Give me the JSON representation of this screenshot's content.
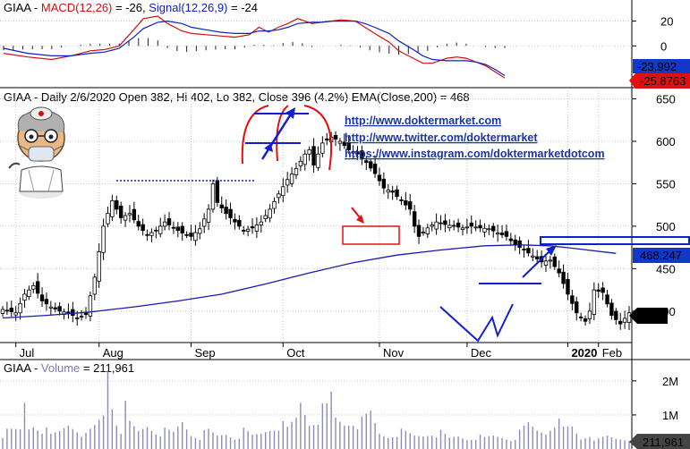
{
  "chart_data": [
    {
      "type": "line",
      "panel": "macd",
      "title": "GIAA - MACD(12,26) = -26, Signal(12,26,9) = -24",
      "title_parts": {
        "ticker": "GIAA - ",
        "macd_label": "MACD(12,26)",
        "macd_eq": " = -26, ",
        "signal_label": "Signal(12,26,9)",
        "signal_eq": " = -24"
      },
      "ylim": [
        -33,
        37
      ],
      "yticks": [
        "20",
        "0"
      ],
      "last_values": {
        "signal": "-23.992",
        "macd": "-25.8763"
      },
      "series": [
        {
          "name": "MACD(12,26)",
          "color": "#d01010",
          "points": [
            [
              0,
              -6
            ],
            [
              5,
              -9
            ],
            [
              10,
              -11
            ],
            [
              14,
              -8
            ],
            [
              18,
              -4
            ],
            [
              21,
              -3
            ],
            [
              24,
              0
            ],
            [
              27,
              13
            ],
            [
              29,
              22
            ],
            [
              32,
              24
            ],
            [
              34,
              18
            ],
            [
              37,
              12
            ],
            [
              39,
              10
            ],
            [
              42,
              9
            ],
            [
              45,
              8
            ],
            [
              48,
              7
            ],
            [
              51,
              9
            ],
            [
              53,
              15
            ],
            [
              55,
              11
            ],
            [
              57,
              15
            ],
            [
              59,
              18
            ],
            [
              61,
              22
            ],
            [
              64,
              18
            ],
            [
              66,
              19
            ],
            [
              68,
              20
            ],
            [
              70,
              21
            ],
            [
              73,
              20
            ],
            [
              75,
              15
            ],
            [
              77,
              10
            ],
            [
              80,
              3
            ],
            [
              82,
              -4
            ],
            [
              85,
              -10
            ],
            [
              87,
              -14
            ],
            [
              89,
              -14
            ],
            [
              92,
              -10
            ],
            [
              94,
              -9
            ],
            [
              96,
              -10
            ],
            [
              98,
              -13
            ],
            [
              100,
              -16
            ],
            [
              102,
              -21
            ],
            [
              104,
              -26
            ]
          ]
        },
        {
          "name": "Signal(12,26,9)",
          "color": "#1020c0",
          "points": [
            [
              0,
              -2
            ],
            [
              5,
              -6
            ],
            [
              10,
              -8
            ],
            [
              14,
              -8
            ],
            [
              18,
              -6
            ],
            [
              21,
              -5
            ],
            [
              24,
              -2
            ],
            [
              27,
              7
            ],
            [
              29,
              14
            ],
            [
              32,
              19
            ],
            [
              34,
              20
            ],
            [
              37,
              18
            ],
            [
              39,
              15
            ],
            [
              42,
              13
            ],
            [
              45,
              11
            ],
            [
              48,
              10
            ],
            [
              51,
              10
            ],
            [
              53,
              12
            ],
            [
              55,
              12
            ],
            [
              57,
              13
            ],
            [
              59,
              15
            ],
            [
              61,
              18
            ],
            [
              64,
              19
            ],
            [
              66,
              19
            ],
            [
              68,
              20
            ],
            [
              70,
              20
            ],
            [
              73,
              20
            ],
            [
              75,
              18
            ],
            [
              77,
              15
            ],
            [
              80,
              10
            ],
            [
              82,
              4
            ],
            [
              85,
              -3
            ],
            [
              87,
              -8
            ],
            [
              89,
              -11
            ],
            [
              92,
              -12
            ],
            [
              94,
              -12
            ],
            [
              96,
              -12
            ],
            [
              98,
              -13
            ],
            [
              100,
              -15
            ],
            [
              102,
              -19
            ],
            [
              104,
              -24
            ]
          ]
        }
      ]
    },
    {
      "type": "candlestick",
      "panel": "price",
      "title": "GIAA - Daily 2/6/2020 Open 382, Hi 402, Lo 382, Close 396 (4.2%) EMA(Close,200) = 468",
      "ylim": [
        363,
        660
      ],
      "yticks": [
        "650",
        "600",
        "550",
        "500",
        "450",
        "400"
      ],
      "xticks": [
        "Jul",
        "Aug",
        "Sep",
        "Oct",
        "Nov",
        "Dec",
        "2020",
        "Feb"
      ],
      "last_close_label": "396",
      "ema_label": "468.247",
      "links": [
        "http://www.doktermarket.com",
        "http://www.twitter.com/doktermarket",
        "https://www.instagram.com/doktermarketdotcom"
      ],
      "close_path": [
        [
          0,
          402
        ],
        [
          3,
          398
        ],
        [
          5,
          420
        ],
        [
          7,
          430
        ],
        [
          9,
          412
        ],
        [
          11,
          405
        ],
        [
          13,
          400
        ],
        [
          15,
          398
        ],
        [
          17,
          392
        ],
        [
          19,
          396
        ],
        [
          21,
          440
        ],
        [
          23,
          500
        ],
        [
          25,
          530
        ],
        [
          27,
          510
        ],
        [
          29,
          515
        ],
        [
          31,
          500
        ],
        [
          33,
          490
        ],
        [
          35,
          495
        ],
        [
          37,
          505
        ],
        [
          39,
          498
        ],
        [
          41,
          492
        ],
        [
          43,
          488
        ],
        [
          45,
          497
        ],
        [
          47,
          520
        ],
        [
          48,
          550
        ],
        [
          49,
          528
        ],
        [
          51,
          515
        ],
        [
          53,
          505
        ],
        [
          55,
          495
        ],
        [
          57,
          498
        ],
        [
          59,
          505
        ],
        [
          61,
          520
        ],
        [
          63,
          538
        ],
        [
          65,
          555
        ],
        [
          67,
          568
        ],
        [
          69,
          585
        ],
        [
          70,
          590
        ],
        [
          71,
          572
        ],
        [
          73,
          598
        ],
        [
          75,
          605
        ],
        [
          77,
          600
        ],
        [
          79,
          590
        ],
        [
          81,
          585
        ],
        [
          83,
          575
        ],
        [
          85,
          562
        ],
        [
          87,
          545
        ],
        [
          89,
          540
        ],
        [
          91,
          530
        ],
        [
          93,
          520
        ],
        [
          94,
          500
        ],
        [
          95,
          488
        ],
        [
          97,
          498
        ],
        [
          99,
          505
        ],
        [
          101,
          502
        ],
        [
          103,
          500
        ],
        [
          105,
          498
        ],
        [
          107,
          500
        ],
        [
          109,
          498
        ],
        [
          111,
          497
        ],
        [
          113,
          492
        ],
        [
          115,
          488
        ],
        [
          117,
          478
        ],
        [
          119,
          472
        ],
        [
          121,
          465
        ],
        [
          123,
          458
        ],
        [
          125,
          460
        ],
        [
          127,
          445
        ],
        [
          129,
          420
        ],
        [
          131,
          398
        ],
        [
          132,
          392
        ],
        [
          133,
          388
        ],
        [
          134,
          400
        ],
        [
          135,
          425
        ],
        [
          137,
          422
        ],
        [
          139,
          395
        ],
        [
          141,
          385
        ],
        [
          143,
          398
        ]
      ],
      "ema200": [
        [
          0,
          392
        ],
        [
          10,
          395
        ],
        [
          20,
          399
        ],
        [
          30,
          405
        ],
        [
          40,
          412
        ],
        [
          50,
          420
        ],
        [
          60,
          432
        ],
        [
          70,
          445
        ],
        [
          80,
          457
        ],
        [
          90,
          466
        ],
        [
          100,
          472
        ],
        [
          110,
          477
        ],
        [
          118,
          478
        ],
        [
          125,
          477
        ],
        [
          132,
          473
        ],
        [
          140,
          468
        ]
      ],
      "volume_pattern": [
        [
          0,
          0.18
        ],
        [
          4,
          0.22
        ],
        [
          5,
          0.55
        ],
        [
          6,
          0.25
        ],
        [
          7,
          0.3
        ],
        [
          9,
          0.25
        ],
        [
          11,
          0.15
        ],
        [
          13,
          0.2
        ],
        [
          15,
          0.3
        ],
        [
          17,
          0.25
        ],
        [
          19,
          0.15
        ],
        [
          21,
          0.25
        ],
        [
          23,
          0.4
        ],
        [
          24,
          1.0
        ],
        [
          25,
          0.55
        ],
        [
          26,
          0.35
        ],
        [
          27,
          0.25
        ],
        [
          28,
          0.45
        ],
        [
          29,
          0.28
        ],
        [
          31,
          0.2
        ],
        [
          33,
          0.28
        ],
        [
          35,
          0.22
        ],
        [
          37,
          0.2
        ],
        [
          39,
          0.18
        ],
        [
          41,
          0.32
        ],
        [
          43,
          0.18
        ],
        [
          45,
          0.15
        ],
        [
          47,
          0.2
        ],
        [
          49,
          0.15
        ],
        [
          51,
          0.18
        ],
        [
          53,
          0.14
        ],
        [
          55,
          0.2
        ],
        [
          57,
          0.15
        ],
        [
          59,
          0.18
        ],
        [
          61,
          0.25
        ],
        [
          63,
          0.3
        ],
        [
          65,
          0.22
        ],
        [
          67,
          0.35
        ],
        [
          68,
          0.55
        ],
        [
          70,
          0.32
        ],
        [
          72,
          0.4
        ],
        [
          74,
          0.45
        ],
        [
          75,
          0.6
        ],
        [
          76,
          0.35
        ],
        [
          78,
          0.3
        ],
        [
          80,
          0.35
        ],
        [
          82,
          0.3
        ],
        [
          84,
          0.4
        ],
        [
          86,
          0.18
        ],
        [
          88,
          0.15
        ],
        [
          90,
          0.2
        ],
        [
          92,
          0.18
        ],
        [
          94,
          0.15
        ],
        [
          96,
          0.16
        ],
        [
          98,
          0.2
        ],
        [
          100,
          0.18
        ],
        [
          102,
          0.12
        ],
        [
          104,
          0.15
        ],
        [
          106,
          0.12
        ],
        [
          108,
          0.15
        ],
        [
          110,
          0.12
        ],
        [
          112,
          0.15
        ],
        [
          114,
          0.14
        ],
        [
          116,
          0.12
        ],
        [
          118,
          0.18
        ],
        [
          120,
          0.28
        ],
        [
          122,
          0.22
        ],
        [
          124,
          0.2
        ],
        [
          126,
          0.35
        ],
        [
          128,
          0.22
        ],
        [
          130,
          0.25
        ],
        [
          132,
          0.12
        ],
        [
          134,
          0.18
        ],
        [
          136,
          0.1
        ],
        [
          138,
          0.14
        ],
        [
          140,
          0.12
        ],
        [
          143,
          0.12
        ]
      ]
    },
    {
      "type": "bar",
      "panel": "volume",
      "title": "GIAA - Volume = 211,961",
      "title_parts": {
        "ticker": "GIAA - ",
        "label": "Volume",
        "eq": " = 211,961"
      },
      "ylim": [
        0,
        2600000
      ],
      "yticks": [
        "2M",
        "1M"
      ],
      "last_value_label": "211,961",
      "bar_color": "#8c8cba"
    }
  ],
  "colors": {
    "up_candle": "#000000",
    "down_candle": "#000000",
    "ema": "#1a1ab0",
    "annotation_red": "#e01010",
    "annotation_blue": "#1020d0",
    "label_blue_bg": "#1238c8",
    "label_red_bg": "#e01010",
    "label_black_bg": "#000000",
    "grid": "#c8c8c8"
  }
}
